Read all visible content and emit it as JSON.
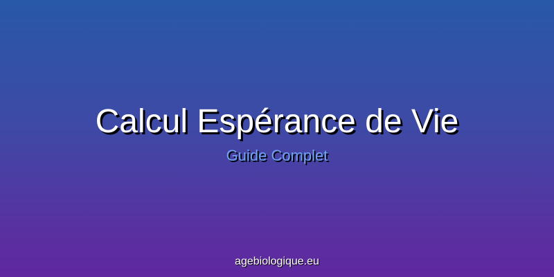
{
  "banner": {
    "title": "Calcul Espérance de Vie",
    "subtitle": "Guide Complet",
    "site": "agebiologique.eu"
  },
  "colors": {
    "gradient_top": "#2858a8",
    "gradient_bottom": "#5f28a0",
    "title": "#ffffff",
    "subtitle": "#6fa2f2",
    "shadow": "#000000"
  }
}
